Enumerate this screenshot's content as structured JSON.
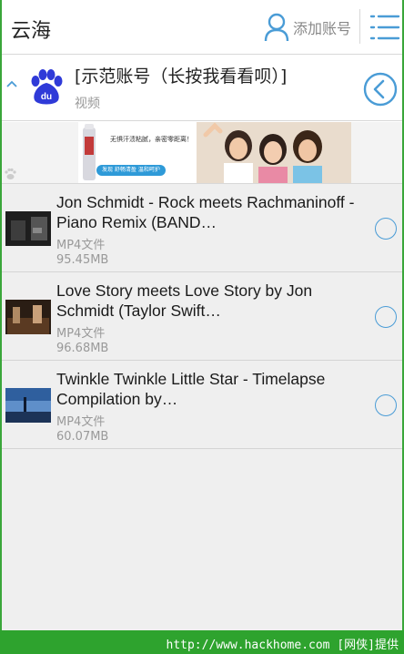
{
  "header": {
    "title": "云海",
    "add_account_label": "添加账号"
  },
  "account": {
    "name": "[示范账号（长按我看看呗）]",
    "type": "视频"
  },
  "banner": {
    "headline": "无惧汗渍粘腻，亲密零距离！",
    "subline": "发现 舒畅清盈 温和呵护"
  },
  "files": [
    {
      "title": "Jon Schmidt - Rock meets Rachmaninoff - Piano Remix (BAND…",
      "type": "MP4文件",
      "size": "95.45MB"
    },
    {
      "title": "Love Story meets Love Story by Jon Schmidt (Taylor Swift…",
      "type": "MP4文件",
      "size": "96.68MB"
    },
    {
      "title": "Twinkle Twinkle Little Star - Timelapse Compilation by…",
      "type": "MP4文件",
      "size": "60.07MB"
    }
  ],
  "footer": {
    "text": "http://www.hackhome.com [网侠]提供"
  },
  "colors": {
    "accent": "#4a9cd6",
    "footer": "#2ea32e",
    "baidu_blue": "#2f3ad8"
  }
}
